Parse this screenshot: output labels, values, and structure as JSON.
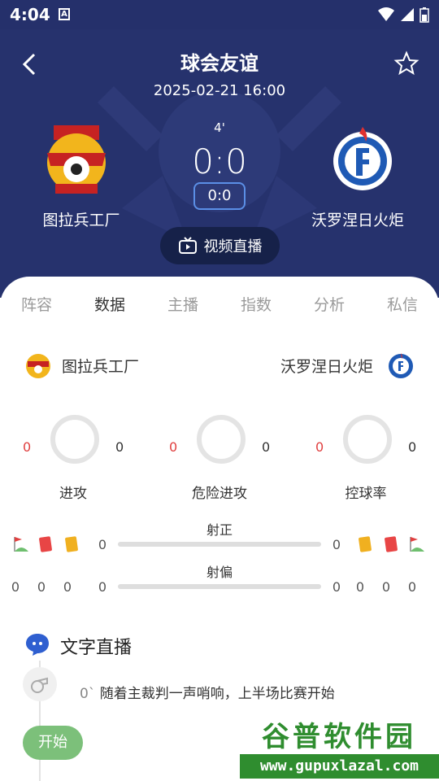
{
  "status_bar": {
    "time": "4:04",
    "notification_icon": "A"
  },
  "header": {
    "title": "球会友谊",
    "datetime": "2025-02-21 16:00",
    "minute": "4'",
    "score": "0:0",
    "half_score": "0:0",
    "home_team": "图拉兵工厂",
    "away_team": "沃罗涅日火炬",
    "video_label": "视频直播"
  },
  "tabs": [
    "阵容",
    "数据",
    "主播",
    "指数",
    "分析",
    "私信"
  ],
  "active_tab": "数据",
  "stats_teams": {
    "home": "图拉兵工厂",
    "away": "沃罗涅日火炬"
  },
  "ring_stats": [
    {
      "label": "进攻",
      "home": "0",
      "away": "0"
    },
    {
      "label": "危险进攻",
      "home": "0",
      "away": "0"
    },
    {
      "label": "控球率",
      "home": "0",
      "away": "0"
    }
  ],
  "bar_stats": [
    {
      "label": "射正",
      "home": "0",
      "away": "0"
    },
    {
      "label": "射偏",
      "home": "0",
      "away": "0"
    }
  ],
  "cards_row": {
    "home_values": [
      "0",
      "0",
      "0"
    ],
    "away_values": [
      "0",
      "0",
      "0"
    ]
  },
  "live": {
    "title": "文字直播",
    "events": [
      {
        "minute": "0`",
        "text": "随着主裁判一声哨响，上半场比赛开始"
      }
    ],
    "start_label": "开始"
  },
  "watermark": {
    "top": "谷普软件园",
    "bottom": "www.gupuxlazal.com"
  },
  "colors": {
    "header_bg": "#26326d",
    "home_value": "#e04040",
    "start_green": "#7cc07a",
    "ring": "#e4e4e4"
  }
}
